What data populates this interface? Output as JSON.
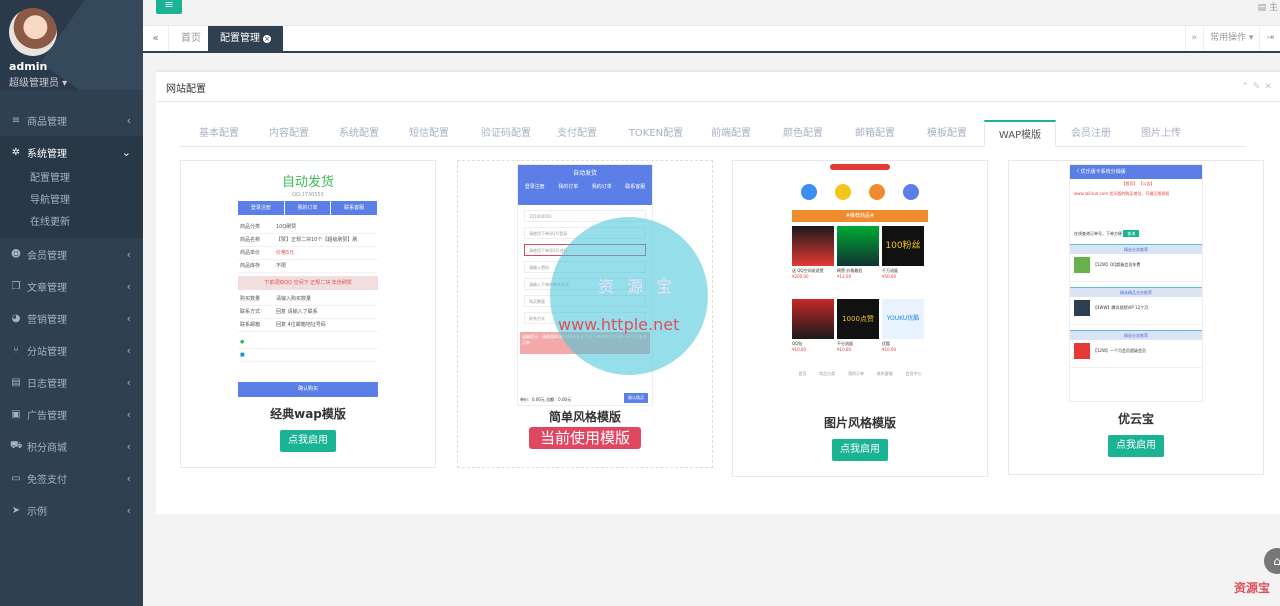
{
  "user": {
    "name": "admin",
    "role": "超级管理员 ▾"
  },
  "sidebar": {
    "items": [
      {
        "label": "商品管理",
        "icon": "list-icon"
      },
      {
        "label": "系统管理",
        "icon": "gear-icon",
        "active": true
      },
      {
        "label": "会员管理",
        "icon": "users-icon"
      },
      {
        "label": "文章管理",
        "icon": "copy-icon"
      },
      {
        "label": "营销管理",
        "icon": "pie-icon"
      },
      {
        "label": "分站管理",
        "icon": "branch-icon"
      },
      {
        "label": "日志管理",
        "icon": "log-icon"
      },
      {
        "label": "广告管理",
        "icon": "image-icon"
      },
      {
        "label": "积分商城",
        "icon": "cart-icon"
      },
      {
        "label": "免签支付",
        "icon": "card-icon"
      },
      {
        "label": "示例",
        "icon": "send-icon"
      }
    ],
    "subitems": [
      "配置管理",
      "导航管理",
      "在线更新"
    ]
  },
  "topbar": {
    "right_text": "主"
  },
  "tabs": {
    "home": "首页",
    "current": "配置管理",
    "common_ops": "常用操作 ▾",
    "exit": "⇥"
  },
  "panel": {
    "title": "网站配置",
    "tabs": [
      "基本配置",
      "内容配置",
      "系统配置",
      "短信配置",
      "验证码配置",
      "支付配置",
      "TOKEN配置",
      "前端配置",
      "颜色配置",
      "邮箱配置",
      "模板配置",
      "WAP模版",
      "会员注册",
      "图片上传"
    ],
    "active_tab": "WAP模版"
  },
  "templates": [
    {
      "name": "经典wap模版",
      "button": "点我启用",
      "preview": {
        "title": "自动发货",
        "subtitle": "QQ:1730555",
        "buttons": [
          "登录注册",
          "我的订单",
          "联系客服"
        ],
        "rows": [
          {
            "label": "商品分类",
            "value": "10Q刷赞"
          },
          {
            "label": "商品名称",
            "value": "【赞】正规二块10个【超级刷赞】刷"
          },
          {
            "label": "商品单价",
            "value": "价格5元"
          },
          {
            "label": "商品库存",
            "value": "不限"
          }
        ],
        "notice": "下单须知QQ 空间下 正规二块 年份刷赞",
        "rows2": [
          {
            "label": "购买数量",
            "value": "请输入购买数量"
          },
          {
            "label": "联系方式",
            "value": "回复 请输入了联系"
          },
          {
            "label": "联系邮箱",
            "value": "回复 4位邮箱地址号码"
          }
        ],
        "pay": "确认购买"
      }
    },
    {
      "name": "简单风格模版",
      "badge": "当前使用模版",
      "preview": {
        "title": "自动发货",
        "icons": [
          "登录注册",
          "我的订单",
          "我的订单",
          "联系客服"
        ],
        "fields": [
          "101000001",
          "请使用下单QQ号登录",
          "请使用下单QQ号进行",
          "请输入密码",
          "请输入下单的联系方式"
        ],
        "qty_label": "购买数量",
        "contact_label": "联系方式",
        "notice": "温馨提示：请使用的QQ号码与在支付宝下单时的QQ号码一致方可查询订单",
        "foot": "单价：0.00元 总额：0.00元",
        "ok": "确认购买"
      },
      "watermark1": "资 源 宝",
      "watermark2": "www.httple.net"
    },
    {
      "name": "图片风格模版",
      "button": "点我启用",
      "preview": {
        "bar": "#推荐商品#",
        "products": [
          {
            "title": "送 QQ空间说说赞",
            "tag": "特惠活动",
            "price": "¥200.00"
          },
          {
            "title": "刷赞 价格最低",
            "tag": "特惠",
            "price": "¥12.00"
          },
          {
            "title": "100粉丝",
            "tag": "千万流量",
            "price": "¥50.00"
          },
          {
            "title": "QQ钻",
            "tag": "会员",
            "price": "¥10.00"
          },
          {
            "title": "1000点赞",
            "tag": "不分流量",
            "price": "¥10.00"
          },
          {
            "title": "YOUKU优酷",
            "tag": "优酷",
            "price": "¥10.00"
          }
        ],
        "footer_items": [
          "首页",
          "商品分类",
          "我的订单",
          "联系客服",
          "会员中心"
        ]
      }
    },
    {
      "name": "优云宝",
      "button": "点我启用",
      "preview": {
        "header": "〈 优乐版卡系统分销版",
        "links": "【首页】 【公告】",
        "notice": "www.lailirun.com 优乐版的购买地址，开通正版授权",
        "search_label": "在线查询订单号，下单方便",
        "search_btn": "查询",
        "sections": [
          "精选业务推荐",
          "精选精品业务推荐",
          "精选业务推荐"
        ],
        "items": [
          "【12W】QQ超级会员年费",
          "【4WW】腾讯视频VIP 12个月",
          "【12W】一个月会员超级会员"
        ]
      }
    }
  ],
  "corner_watermark": "资源宝",
  "home_icon": "home-icon"
}
